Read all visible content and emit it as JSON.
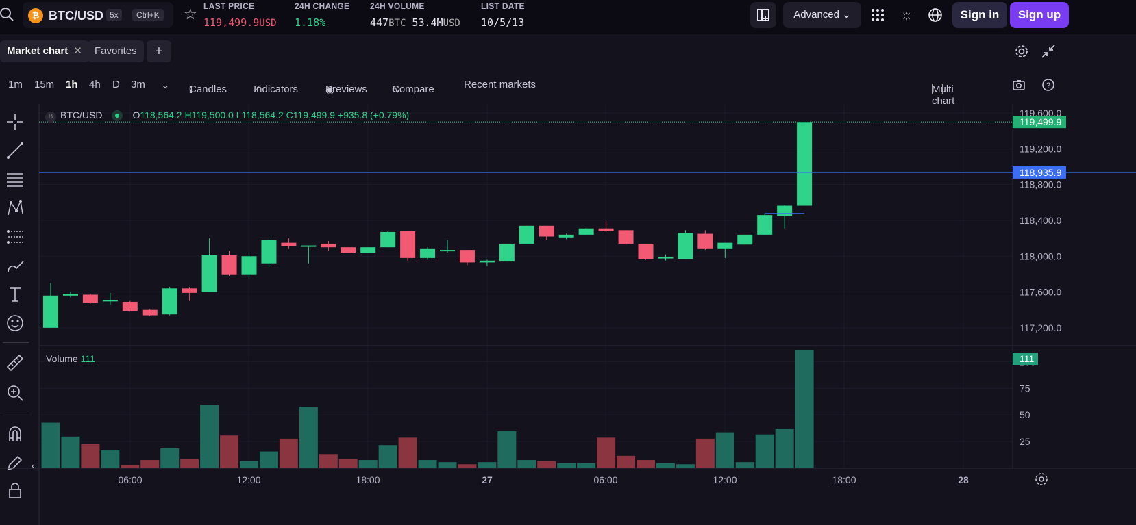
{
  "header": {
    "pair": "BTC/USD",
    "leverage": "5x",
    "shortcut": "Ctrl+K",
    "coin_letter": "₿",
    "stats": [
      {
        "label": "LAST PRICE",
        "value": "119,499.9",
        "unit": "USD"
      },
      {
        "label": "24H CHANGE",
        "value": "1.18%"
      },
      {
        "label": "24H VOLUME",
        "value": "447",
        "unit": "BTC",
        "value2": "53.4M",
        "unit2": "USD"
      },
      {
        "label": "LIST DATE",
        "value": "10/5/13"
      }
    ],
    "mode": "Advanced",
    "signin": "Sign in",
    "signup": "Sign up"
  },
  "tabs": [
    {
      "label": "Market chart"
    },
    {
      "label": "Favorites"
    }
  ],
  "toolbar": {
    "intervals": [
      "1m",
      "15m",
      "1h",
      "4h",
      "D",
      "3m"
    ],
    "active_interval": "1h",
    "candles": "Candles",
    "indicators": "Indicators",
    "previews": "Previews",
    "compare": "Compare",
    "recent": "Recent markets",
    "multi": "Multi chart"
  },
  "legend": {
    "symbol": "BTC/USD",
    "o": "O118,564.2",
    "h": "H119,500.0",
    "l": "L118,564.2",
    "c": "C119,499.9",
    "chg": "+935.8 (+0.79%)"
  },
  "volume_label": "Volume",
  "volume_value": "111",
  "colors": {
    "up": "#2fd38a",
    "down": "#f25a73",
    "vol_up": "#1f6b5e",
    "vol_down": "#8b3540",
    "hline": "#3b6ef5",
    "bg": "#14121d"
  },
  "chart_data": {
    "type": "candlestick",
    "price_axis": {
      "ticks": [
        "119,600.0",
        "119,200.0",
        "118,800.0",
        "118,400.0",
        "118,000.0",
        "117,600.0",
        "117,200.0"
      ],
      "ylim": [
        117000,
        119700
      ]
    },
    "current_price_label": "119,499.9",
    "hline_label": "118,935.9",
    "hline_value": 118935.9,
    "volume_axis": {
      "ticks": [
        "100",
        "75",
        "50",
        "25"
      ],
      "ylim": [
        0,
        115
      ]
    },
    "x_ticks": [
      "06:00",
      "12:00",
      "18:00",
      "27",
      "06:00",
      "12:00",
      "18:00",
      "28"
    ],
    "candles": [
      {
        "o": 117200,
        "h": 117700,
        "l": 117200,
        "c": 117560,
        "v": 43
      },
      {
        "o": 117560,
        "h": 117600,
        "l": 117540,
        "c": 117580,
        "v": 30
      },
      {
        "o": 117570,
        "h": 117580,
        "l": 117470,
        "c": 117480,
        "v": 23
      },
      {
        "o": 117500,
        "h": 117590,
        "l": 117460,
        "c": 117510,
        "v": 17
      },
      {
        "o": 117490,
        "h": 117500,
        "l": 117380,
        "c": 117390,
        "v": 3
      },
      {
        "o": 117400,
        "h": 117410,
        "l": 117330,
        "c": 117340,
        "v": 8
      },
      {
        "o": 117350,
        "h": 117650,
        "l": 117340,
        "c": 117640,
        "v": 19
      },
      {
        "o": 117640,
        "h": 117650,
        "l": 117500,
        "c": 117590,
        "v": 9
      },
      {
        "o": 117600,
        "h": 118200,
        "l": 117600,
        "c": 118010,
        "v": 60
      },
      {
        "o": 118010,
        "h": 118060,
        "l": 117780,
        "c": 117790,
        "v": 31
      },
      {
        "o": 117790,
        "h": 118020,
        "l": 117770,
        "c": 118000,
        "v": 7
      },
      {
        "o": 117920,
        "h": 118200,
        "l": 117880,
        "c": 118180,
        "v": 16
      },
      {
        "o": 118150,
        "h": 118200,
        "l": 118080,
        "c": 118110,
        "v": 28
      },
      {
        "o": 118110,
        "h": 118110,
        "l": 117920,
        "c": 118120,
        "v": 58
      },
      {
        "o": 118140,
        "h": 118170,
        "l": 118060,
        "c": 118100,
        "v": 13
      },
      {
        "o": 118100,
        "h": 118100,
        "l": 118040,
        "c": 118040,
        "v": 9
      },
      {
        "o": 118040,
        "h": 118100,
        "l": 118040,
        "c": 118100,
        "v": 8
      },
      {
        "o": 118100,
        "h": 118280,
        "l": 118100,
        "c": 118270,
        "v": 22
      },
      {
        "o": 118280,
        "h": 118280,
        "l": 117950,
        "c": 117980,
        "v": 29
      },
      {
        "o": 117980,
        "h": 118100,
        "l": 117960,
        "c": 118080,
        "v": 8
      },
      {
        "o": 118060,
        "h": 118180,
        "l": 118040,
        "c": 118070,
        "v": 6
      },
      {
        "o": 118070,
        "h": 118070,
        "l": 117900,
        "c": 117930,
        "v": 4
      },
      {
        "o": 117930,
        "h": 117960,
        "l": 117890,
        "c": 117950,
        "v": 6
      },
      {
        "o": 117940,
        "h": 118140,
        "l": 117940,
        "c": 118140,
        "v": 35
      },
      {
        "o": 118140,
        "h": 118340,
        "l": 118140,
        "c": 118340,
        "v": 8
      },
      {
        "o": 118340,
        "h": 118340,
        "l": 118180,
        "c": 118220,
        "v": 7
      },
      {
        "o": 118210,
        "h": 118250,
        "l": 118190,
        "c": 118240,
        "v": 5
      },
      {
        "o": 118240,
        "h": 118320,
        "l": 118240,
        "c": 118310,
        "v": 5
      },
      {
        "o": 118310,
        "h": 118390,
        "l": 118270,
        "c": 118280,
        "v": 29
      },
      {
        "o": 118290,
        "h": 118290,
        "l": 118120,
        "c": 118140,
        "v": 12
      },
      {
        "o": 118140,
        "h": 118140,
        "l": 117960,
        "c": 117970,
        "v": 8
      },
      {
        "o": 117980,
        "h": 118020,
        "l": 117950,
        "c": 117990,
        "v": 5
      },
      {
        "o": 117970,
        "h": 118290,
        "l": 117970,
        "c": 118260,
        "v": 4
      },
      {
        "o": 118250,
        "h": 118290,
        "l": 118070,
        "c": 118080,
        "v": 28
      },
      {
        "o": 118080,
        "h": 118150,
        "l": 117980,
        "c": 118150,
        "v": 34
      },
      {
        "o": 118130,
        "h": 118240,
        "l": 118130,
        "c": 118240,
        "v": 6
      },
      {
        "o": 118240,
        "h": 118480,
        "l": 118240,
        "c": 118460,
        "v": 32
      },
      {
        "o": 118450,
        "h": 118570,
        "l": 118310,
        "c": 118564,
        "v": 37
      },
      {
        "o": 118564,
        "h": 119500,
        "l": 118564,
        "c": 119499,
        "v": 111
      }
    ]
  }
}
